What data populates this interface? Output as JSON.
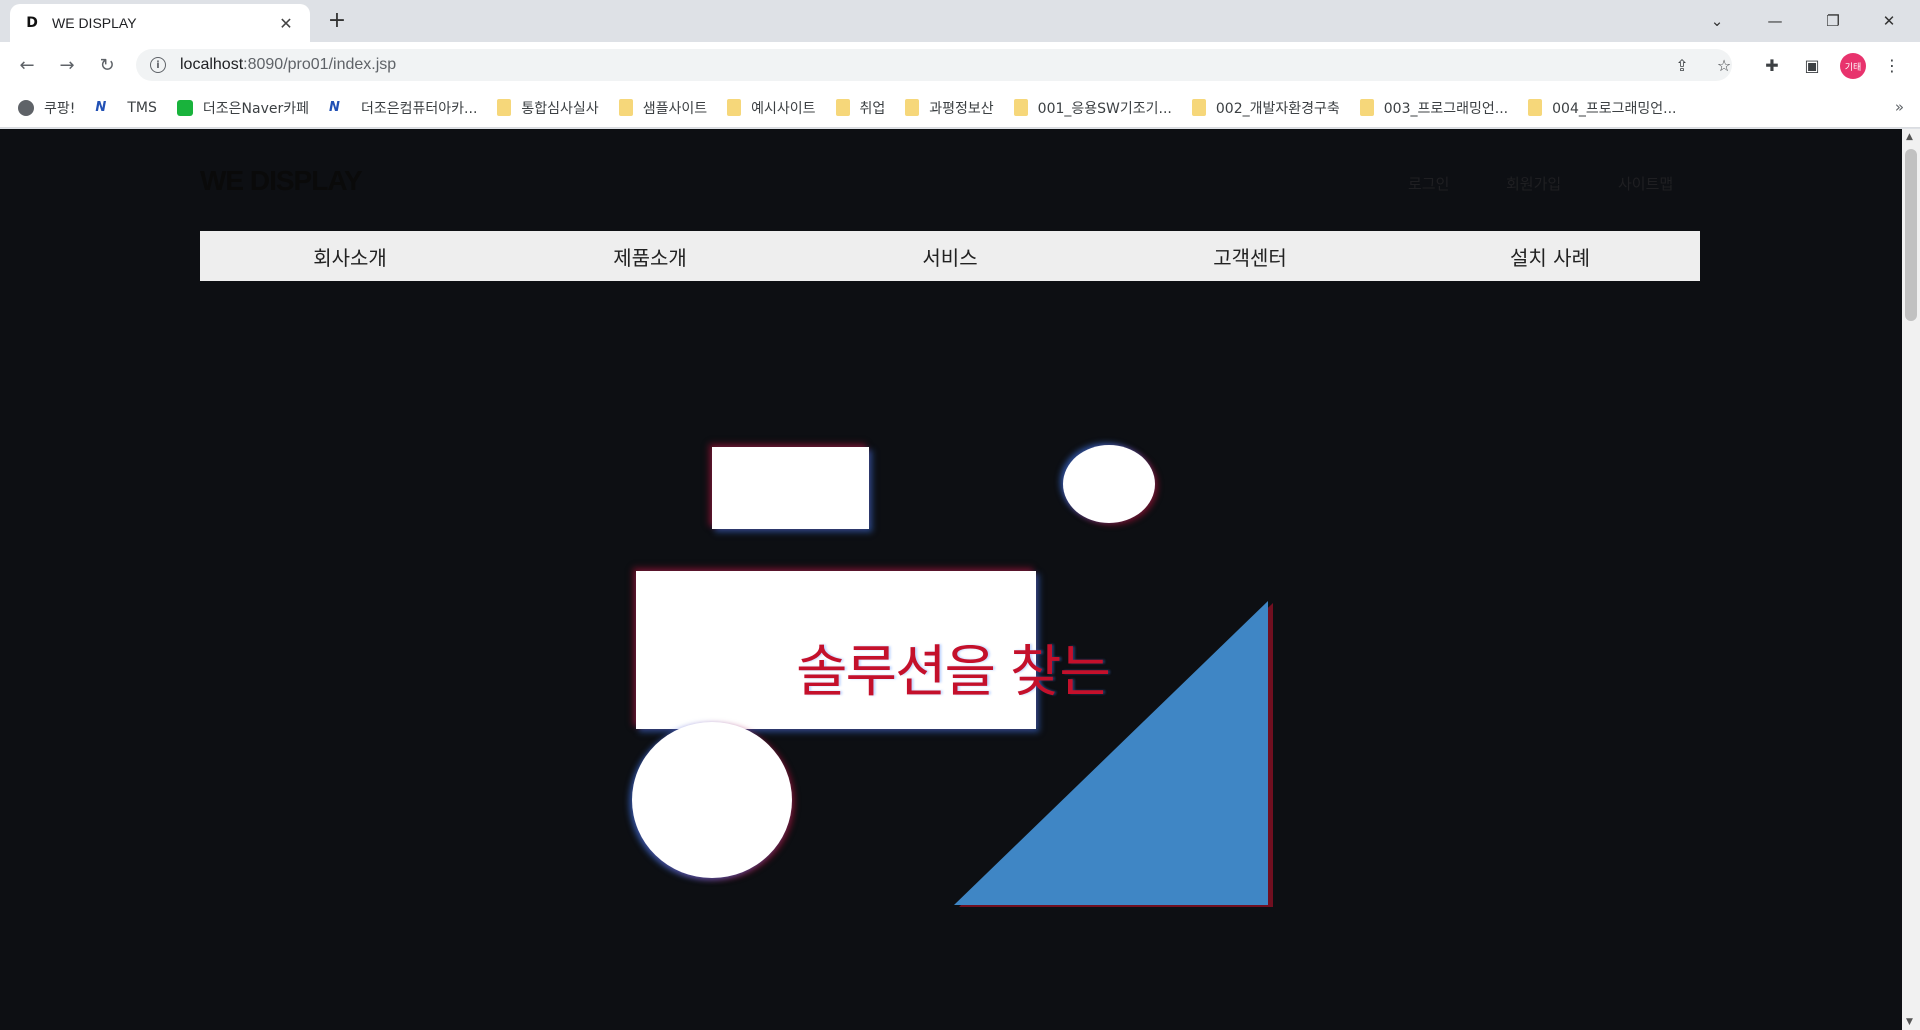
{
  "browser": {
    "tab": {
      "title": "WE DISPLAY",
      "favicon": "D"
    },
    "url": {
      "host": "localhost",
      "path": ":8090/pro01/index.jsp"
    },
    "profile": "기태",
    "bookmarks": [
      {
        "label": "쿠팡!",
        "icon": "globe-icon"
      },
      {
        "label": "TMS",
        "icon": "tms-icon"
      },
      {
        "label": "더조은Naver카페",
        "icon": "naver-cafe-icon"
      },
      {
        "label": "더조은컴퓨터아카...",
        "icon": "tms-icon"
      },
      {
        "label": "통합심사실사",
        "icon": "folder-icon"
      },
      {
        "label": "샘플사이트",
        "icon": "folder-icon"
      },
      {
        "label": "예시사이트",
        "icon": "folder-icon"
      },
      {
        "label": "취업",
        "icon": "folder-icon"
      },
      {
        "label": "과평정보산",
        "icon": "folder-icon"
      },
      {
        "label": "001_응용SW기조기...",
        "icon": "folder-icon"
      },
      {
        "label": "002_개발자환경구축",
        "icon": "folder-icon"
      },
      {
        "label": "003_프로그래밍언...",
        "icon": "folder-icon"
      },
      {
        "label": "004_프로그래밍언...",
        "icon": "folder-icon"
      }
    ],
    "bookmarks_more": "»"
  },
  "site": {
    "logo": "WE DISPLAY",
    "util": {
      "login": "로그인",
      "join": "회원가입",
      "sitemap": "사이트맵"
    },
    "nav": [
      "회사소개",
      "제품소개",
      "서비스",
      "고객센터",
      "설치 사례"
    ],
    "hero_text": "솔루션을 찾는"
  },
  "colors": {
    "page_bg": "#0d0f13",
    "accent_red": "#c4102b",
    "triangle_blue": "#3f86c5",
    "nav_bg": "#eeeeee"
  }
}
